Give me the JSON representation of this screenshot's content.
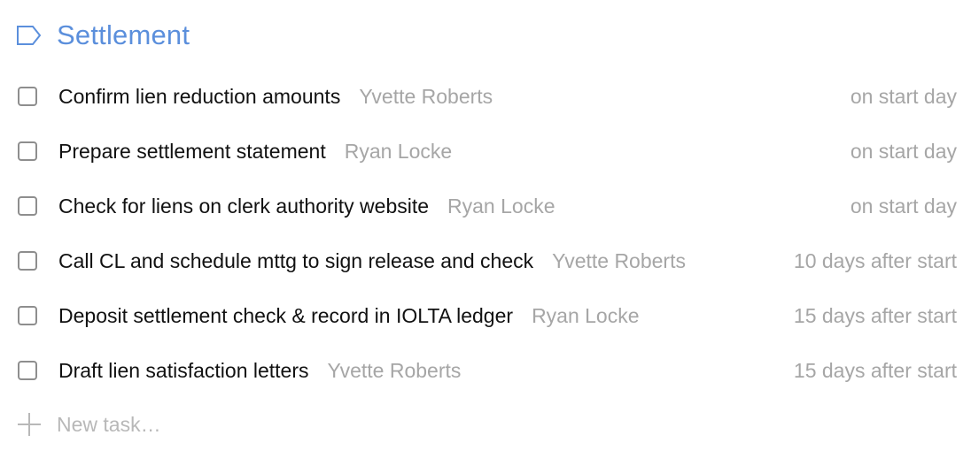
{
  "section": {
    "title": "Settlement",
    "icon": "tag-icon",
    "accent_color": "#5b8fdc"
  },
  "tasks": [
    {
      "title": "Confirm lien reduction amounts",
      "assignee": "Yvette Roberts",
      "due": "on start day",
      "checked": false
    },
    {
      "title": "Prepare settlement statement",
      "assignee": "Ryan Locke",
      "due": "on start day",
      "checked": false
    },
    {
      "title": "Check for liens on clerk authority website",
      "assignee": "Ryan Locke",
      "due": "on start day",
      "checked": false
    },
    {
      "title": "Call CL and schedule mttg to sign release and check",
      "assignee": "Yvette Roberts",
      "due": "10 days after start",
      "checked": false
    },
    {
      "title": "Deposit settlement check & record in IOLTA ledger",
      "assignee": "Ryan Locke",
      "due": "15 days after start",
      "checked": false
    },
    {
      "title": "Draft lien satisfaction letters",
      "assignee": "Yvette Roberts",
      "due": "15 days after start",
      "checked": false
    }
  ],
  "new_task": {
    "placeholder": "New task…",
    "icon": "plus-icon"
  }
}
